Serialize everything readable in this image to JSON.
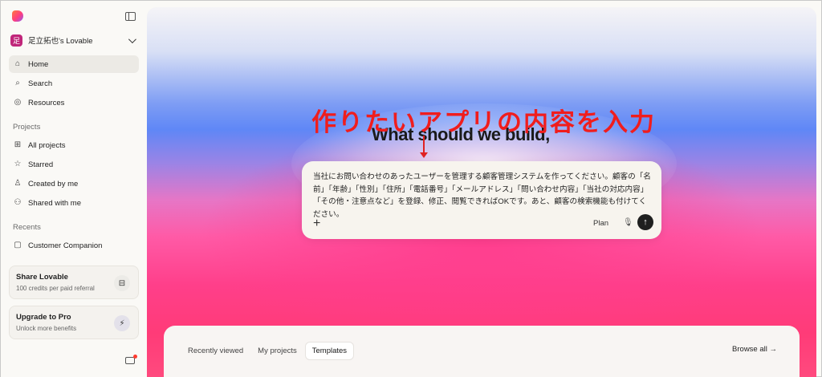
{
  "sidebar": {
    "workspace": {
      "badge": "足",
      "name": "足立拓也's Lovable"
    },
    "nav": [
      {
        "icon": "home-icon",
        "glyph": "⌂",
        "label": "Home",
        "active": true
      },
      {
        "icon": "search-icon",
        "glyph": "⌕",
        "label": "Search"
      },
      {
        "icon": "compass-icon",
        "glyph": "◎",
        "label": "Resources"
      }
    ],
    "projects_label": "Projects",
    "projects": [
      {
        "icon": "grid-icon",
        "glyph": "⊞",
        "label": "All projects"
      },
      {
        "icon": "star-icon",
        "glyph": "☆",
        "label": "Starred"
      },
      {
        "icon": "user-icon",
        "glyph": "♙",
        "label": "Created by me"
      },
      {
        "icon": "users-icon",
        "glyph": "⚇",
        "label": "Shared with me"
      }
    ],
    "recents_label": "Recents",
    "recents": [
      {
        "icon": "file-icon",
        "glyph": "▢",
        "label": "Customer Companion"
      }
    ],
    "share_card": {
      "title": "Share Lovable",
      "subtitle": "100 credits per paid referral",
      "icon": "gift-icon",
      "glyph": "⊟"
    },
    "upgrade_card": {
      "title": "Upgrade to Pro",
      "subtitle": "Unlock more benefits",
      "icon": "bolt-icon",
      "glyph": "⚡"
    }
  },
  "main": {
    "annotation": "作りたいアプリの内容を入力",
    "headline": "What should we build,",
    "prompt": {
      "text": "当社にお問い合わせのあったユーザーを管理する顧客管理システムを作ってください。顧客の「名前」「年齢」「性別」「住所」「電話番号」「メールアドレス」「問い合わせ内容」「当社の対応内容」「その他・注意点など」を登録、修正、閲覧できればOKです。あと、顧客の検索機能も付けてください。",
      "plan_label": "Plan"
    },
    "tabs": [
      {
        "label": "Recently viewed",
        "active": false
      },
      {
        "label": "My projects",
        "active": false
      },
      {
        "label": "Templates",
        "active": true
      }
    ],
    "browse_all": "Browse all →"
  },
  "colors": {
    "accent": "#ff3f8a",
    "annotation_red": "#f01d1d",
    "send_button": "#1f1f1f"
  }
}
